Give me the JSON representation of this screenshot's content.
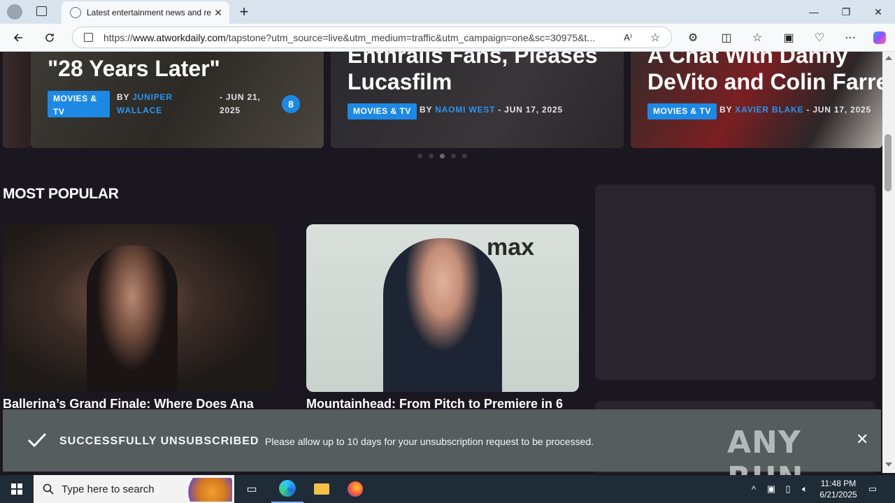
{
  "browser": {
    "tab_title": "Latest entertainment news and re",
    "tab_close": "✕",
    "new_tab": "+",
    "url_prefix": "https://",
    "url_domain": "www.atworkdaily.com",
    "url_rest": "/tapstone?utm_source=live&utm_medium=traffic&utm_campaign=one&sc=30975&t...",
    "win_min": "—",
    "win_restore": "❐",
    "win_close": "✕"
  },
  "carousel": {
    "slides": [
      {
        "title": "\"28 Years Later\"",
        "category": "MOVIES & TV",
        "by": "BY",
        "author": "JUNIPER WALLACE",
        "date": "- JUN 21, 2025",
        "badge": "8"
      },
      {
        "title_line1": "Enthralls Fans, Pleases",
        "title_line2": "Lucasfilm",
        "category": "MOVIES & TV",
        "by": "BY",
        "author": "NAOMI WEST",
        "date": "- JUN 17, 2025"
      },
      {
        "title_line1": "A Chat With Danny",
        "title_line2": "DeVito and Colin Farrell",
        "category": "MOVIES & TV",
        "by": "BY",
        "author": "XAVIER BLAKE",
        "date": "- JUN 17, 2025"
      }
    ],
    "active_dot": 3
  },
  "most_popular": {
    "heading": "MOST POPULAR",
    "cards": [
      {
        "title": "Ballerina’s Grand Finale: Where Does Ana"
      },
      {
        "title": "Mountainhead: From Pitch to Premiere in 6"
      }
    ]
  },
  "toast": {
    "heading": "SUCCESSFULLY UNSUBSCRIBED",
    "message": "Please allow up to 10 days for your unsubscription request to be processed.",
    "close": "✕",
    "watermark": "ANY RUN"
  },
  "taskbar": {
    "search_placeholder": "Type here to search",
    "time": "11:48 PM",
    "date": "6/21/2025"
  },
  "colors": {
    "accent": "#1e88e5",
    "author": "#2b95f0",
    "page_bg": "#1b1720",
    "toast_bg": "#57605f"
  }
}
